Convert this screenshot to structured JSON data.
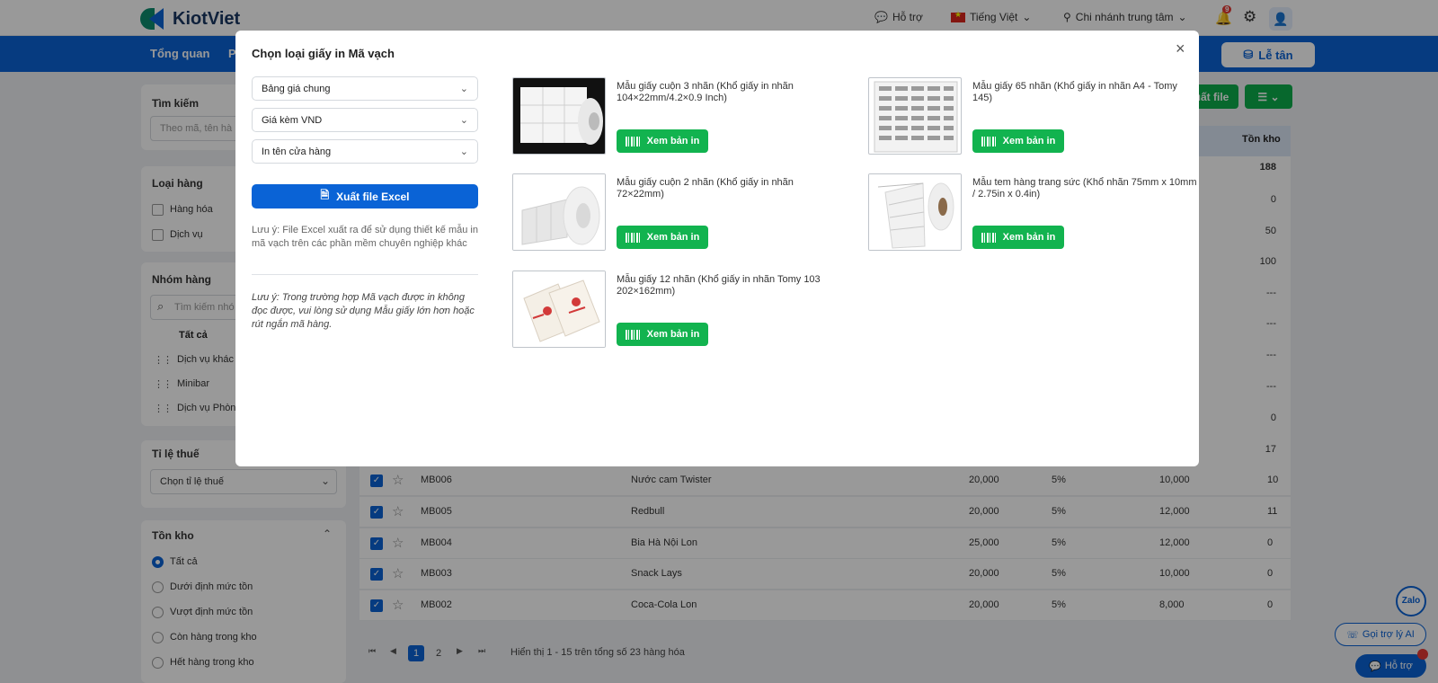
{
  "topbar": {
    "brand": "KiotViet",
    "support": "Hỗ trợ",
    "language": "Tiếng Việt",
    "branch": "Chi nhánh trung tâm",
    "notif_count": "9"
  },
  "nav": {
    "items": [
      "Tổng quan",
      "P"
    ],
    "reception": "Lễ tân"
  },
  "sidebar": {
    "search": {
      "title": "Tìm kiếm",
      "placeholder": "Theo mã, tên hà"
    },
    "types": {
      "title": "Loại hàng",
      "items": [
        "Hàng hóa",
        "Dịch vụ"
      ]
    },
    "groups": {
      "title": "Nhóm hàng",
      "search_placeholder": "Tìm kiếm nhó",
      "all": "Tất cả",
      "items": [
        "Dịch vụ khác",
        "Minibar",
        "Dịch vụ Phòn"
      ]
    },
    "tax": {
      "title": "Tỉ lệ thuế",
      "placeholder": "Chọn tỉ lệ thuế"
    },
    "stock": {
      "title": "Tồn kho",
      "options": [
        "Tất cả",
        "Dưới định mức tồn",
        "Vượt định mức tồn",
        "Còn hàng trong kho",
        "Hết hàng trong kho"
      ]
    }
  },
  "toolbar": {
    "export": "uất file"
  },
  "table": {
    "stock_header": "Tồn kho",
    "upper_stock": [
      "188",
      "0",
      "50",
      "100",
      "---",
      "---",
      "---",
      "---",
      "0",
      "17"
    ],
    "rows": [
      {
        "code": "MB006",
        "name": "Nước cam Twister",
        "price": "20,000",
        "tax": "5%",
        "cost": "10,000",
        "stock": "10"
      },
      {
        "code": "MB005",
        "name": "Redbull",
        "price": "20,000",
        "tax": "5%",
        "cost": "12,000",
        "stock": "11"
      },
      {
        "code": "MB004",
        "name": "Bia Hà Nội Lon",
        "price": "25,000",
        "tax": "5%",
        "cost": "12,000",
        "stock": "0"
      },
      {
        "code": "MB003",
        "name": "Snack Lays",
        "price": "20,000",
        "tax": "5%",
        "cost": "10,000",
        "stock": "0"
      },
      {
        "code": "MB002",
        "name": "Coca-Cola Lon",
        "price": "20,000",
        "tax": "5%",
        "cost": "8,000",
        "stock": "0"
      }
    ]
  },
  "pager": {
    "page1": "1",
    "page2": "2",
    "info": "Hiển thị 1 - 15 trên tổng số 23 hàng hóa"
  },
  "floating": {
    "zalo": "Zalo",
    "ai": "Gọi trợ lý AI",
    "help": "Hỗ trợ"
  },
  "modal": {
    "title": "Chọn loại giấy in Mã vạch",
    "selects": [
      "Bảng giá chung",
      "Giá kèm VND",
      "In tên cửa hàng"
    ],
    "export_excel": "Xuất file Excel",
    "note1": "Lưu ý: File Excel xuất ra để sử dụng thiết kế mẫu in mã vạch trên các phần mềm chuyên nghiệp khác",
    "note2": "Lưu ý: Trong trường hợp Mã vạch được in không đọc được, vui lòng sử dụng Mẫu giấy lớn hơn hoặc rút ngắn mã hàng.",
    "preview_label": "Xem bản in",
    "papers": [
      {
        "desc": "Mẫu giấy cuộn 3 nhãn (Khổ giấy in nhãn 104×22mm/4.2×0.9 Inch)"
      },
      {
        "desc": "Mẫu giấy 65 nhãn (Khổ giấy in nhãn A4 - Tomy 145)"
      },
      {
        "desc": "Mẫu giấy cuộn 2 nhãn (Khổ giấy in nhãn 72×22mm)"
      },
      {
        "desc": "Mẫu tem hàng trang sức (Khổ nhãn 75mm x 10mm / 2.75in x 0.4in)"
      },
      {
        "desc": "Mẫu giấy 12 nhãn (Khổ giấy in nhãn Tomy 103 202×162mm)"
      }
    ]
  }
}
